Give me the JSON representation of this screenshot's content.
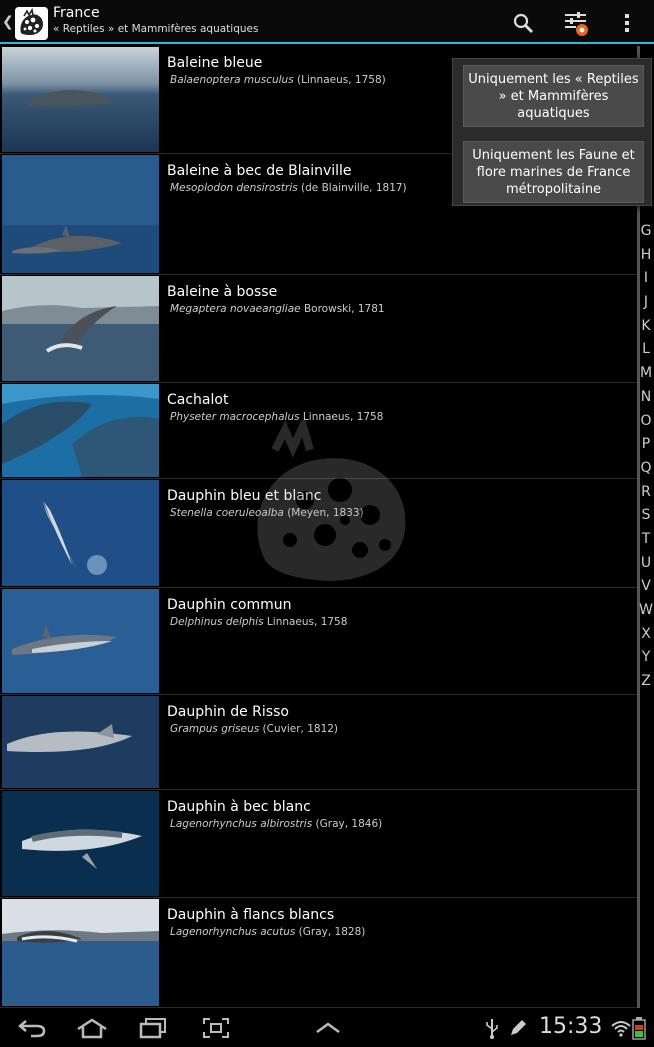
{
  "header": {
    "title": "France",
    "subtitle": "« Reptiles » et Mammifères aquatiques",
    "icons": [
      "search-icon",
      "filter-settings-icon",
      "overflow-menu-icon"
    ]
  },
  "species": [
    {
      "common": "Baleine bleue",
      "latin": "Balaenoptera musculus",
      "author": "(Linnaeus, 1758)"
    },
    {
      "common": "Baleine à bec de Blainville",
      "latin": "Mesoplodon densirostris",
      "author": "(de Blainville, 1817)"
    },
    {
      "common": "Baleine à bosse",
      "latin": "Megaptera novaeangliae",
      "author": "Borowski, 1781"
    },
    {
      "common": "Cachalot",
      "latin": "Physeter macrocephalus",
      "author": "Linnaeus, 1758"
    },
    {
      "common": "Dauphin bleu et blanc",
      "latin": "Stenella coeruleoalba",
      "author": "(Meyen, 1833)"
    },
    {
      "common": "Dauphin commun",
      "latin": "Delphinus delphis",
      "author": "Linnaeus, 1758"
    },
    {
      "common": "Dauphin de Risso",
      "latin": "Grampus griseus",
      "author": "(Cuvier, 1812)"
    },
    {
      "common": "Dauphin à bec blanc",
      "latin": "Lagenorhynchus albirostris",
      "author": "(Gray, 1846)"
    },
    {
      "common": "Dauphin à flancs blancs",
      "latin": "Lagenorhynchus acutus",
      "author": "(Gray, 1828)"
    }
  ],
  "index_letters": [
    "G",
    "H",
    "I",
    "J",
    "K",
    "L",
    "M",
    "N",
    "O",
    "P",
    "Q",
    "R",
    "S",
    "T",
    "U",
    "V",
    "W",
    "X",
    "Y",
    "Z"
  ],
  "popup_menu": [
    {
      "label": "Uniquement les « Reptiles » et Mammifères aquatiques"
    },
    {
      "label": "Uniquement les Faune et flore marines de France métropolitaine"
    }
  ],
  "navbar": {
    "clock": "15:33",
    "icons": [
      "back-icon",
      "home-icon",
      "recent-apps-icon",
      "screenshot-icon",
      "menu-up-icon",
      "usb-icon",
      "edit-icon",
      "wifi-icon",
      "battery-icon"
    ]
  },
  "colors": {
    "accent": "#33b5e5",
    "background": "#000000"
  }
}
